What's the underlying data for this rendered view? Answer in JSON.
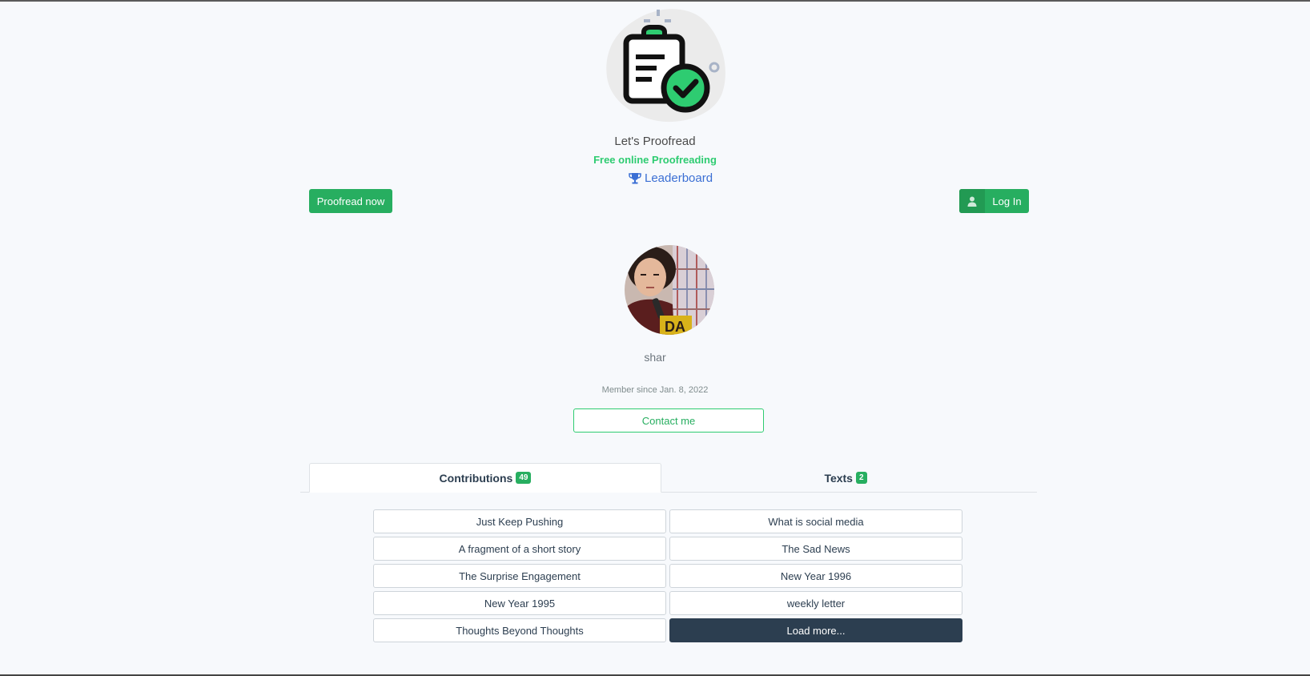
{
  "brand": {
    "title": "Let's Proofread",
    "tagline": "Free online Proofreading",
    "leaderboard_label": "Leaderboard"
  },
  "actions": {
    "proofread_now_label": "Proofread now",
    "login_label": "Log In"
  },
  "profile": {
    "username": "shar",
    "member_since": "Member since Jan. 8, 2022",
    "contact_label": "Contact me"
  },
  "tabs": [
    {
      "label": "Contributions",
      "count": "49",
      "active": true
    },
    {
      "label": "Texts",
      "count": "2",
      "active": false
    }
  ],
  "texts": [
    "Just Keep Pushing",
    "What is social media",
    "A fragment of a short story",
    "The Sad News",
    "The Surprise Engagement",
    "New Year 1996",
    "New Year 1995",
    "weekly letter",
    "Thoughts Beyond Thoughts"
  ],
  "load_more_label": "Load more...",
  "colors": {
    "primary_green": "#27ae60",
    "accent_green": "#2ecc71",
    "dark": "#2c3e50",
    "link_blue": "#3b6fd4",
    "background": "#f7f9fc"
  }
}
